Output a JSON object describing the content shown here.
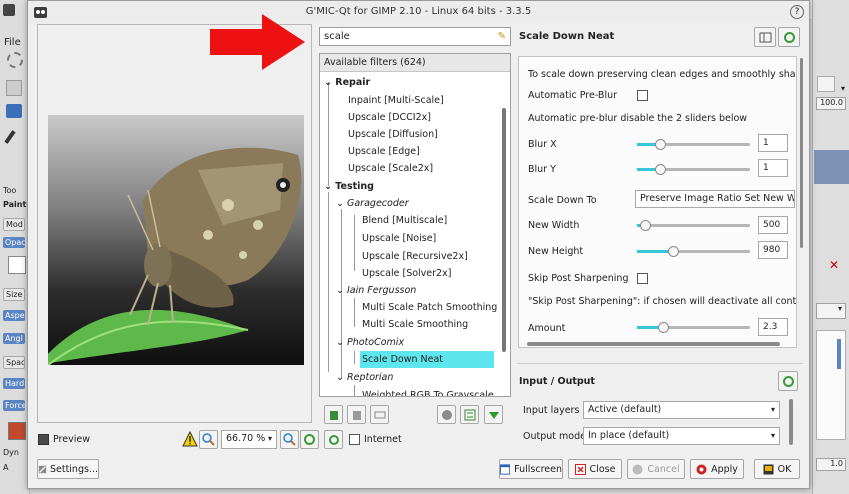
{
  "window": {
    "title": "G'MIC-Qt for GIMP 2.10 - Linux 64 bits - 3.3.5"
  },
  "gimp_background": {
    "menu_file": "File",
    "left_labels": [
      "Too",
      "Painti",
      "Mod",
      "Opac",
      "Size",
      "Aspe",
      "Angl",
      "Spaci",
      "Hard",
      "Force",
      "Dyn",
      "A"
    ],
    "right_values": [
      "100.0",
      "1.0"
    ]
  },
  "preview": {
    "preview_label": "Preview",
    "preview_checked": true,
    "zoom_value": "66.70 %",
    "settings_button": "Settings..."
  },
  "filters": {
    "search_value": "scale",
    "header": "Available filters (624)",
    "internet_label": "Internet",
    "internet_checked": false,
    "tree": [
      {
        "label": "Repair",
        "kind": "category"
      },
      {
        "label": "Inpaint [Multi-Scale]",
        "kind": "item"
      },
      {
        "label": "Upscale [DCCI2x]",
        "kind": "item"
      },
      {
        "label": "Upscale [Diffusion]",
        "kind": "item"
      },
      {
        "label": "Upscale [Edge]",
        "kind": "item"
      },
      {
        "label": "Upscale [Scale2x]",
        "kind": "item"
      },
      {
        "label": "Testing",
        "kind": "category"
      },
      {
        "label": "Garagecoder",
        "kind": "author"
      },
      {
        "label": "Blend [Multiscale]",
        "kind": "subitem"
      },
      {
        "label": "Upscale [Noise]",
        "kind": "subitem"
      },
      {
        "label": "Upscale [Recursive2x]",
        "kind": "subitem"
      },
      {
        "label": "Upscale [Solver2x]",
        "kind": "subitem"
      },
      {
        "label": "Iain Fergusson",
        "kind": "author"
      },
      {
        "label": "Multi Scale Patch Smoothing",
        "kind": "subitem"
      },
      {
        "label": "Multi Scale Smoothing",
        "kind": "subitem"
      },
      {
        "label": "PhotoComix",
        "kind": "author"
      },
      {
        "label": "Scale Down Neat",
        "kind": "subitem",
        "selected": true
      },
      {
        "label": "Reptorian",
        "kind": "author"
      },
      {
        "label": "Weighted RGB To Grayscale",
        "kind": "subitem"
      }
    ]
  },
  "settings": {
    "filter_name": "Scale Down Neat",
    "description": "To scale down preserving clean edges and smoothly sharpen",
    "auto_preblur_label": "Automatic Pre-Blur",
    "auto_preblur_checked": false,
    "auto_preblur_note": "Automatic pre-blur disable the 2 sliders below",
    "blur_x_label": "Blur X",
    "blur_x_value": "1",
    "blur_x_level": 0.2,
    "blur_y_label": "Blur Y",
    "blur_y_value": "1",
    "blur_y_level": 0.2,
    "scale_down_to_label": "Scale Down To",
    "scale_down_to_value": "Preserve Image Ratio Set New Width",
    "new_width_label": "New Width",
    "new_width_value": "500",
    "new_width_level": 0.07,
    "new_height_label": "New Height",
    "new_height_value": "980",
    "new_height_level": 0.32,
    "skip_sharpen_label": "Skip Post Sharpening",
    "skip_sharpen_checked": false,
    "skip_sharpen_note": "\"Skip Post Sharpening\": if chosen will deactivate all controls belo",
    "amount_label": "Amount",
    "amount_value": "2.3",
    "amount_level": 0.23
  },
  "io": {
    "title": "Input / Output",
    "input_layers_label": "Input layers",
    "input_layers_value": "Active (default)",
    "output_mode_label": "Output mode",
    "output_mode_value": "In place (default)"
  },
  "footer": {
    "fullscreen": "Fullscreen",
    "close": "Close",
    "cancel": "Cancel",
    "apply": "Apply",
    "ok": "OK"
  },
  "colors": {
    "selection": "#5ee6ee",
    "slider_fill": "#37c6d8",
    "arrow": "#ee1111"
  }
}
